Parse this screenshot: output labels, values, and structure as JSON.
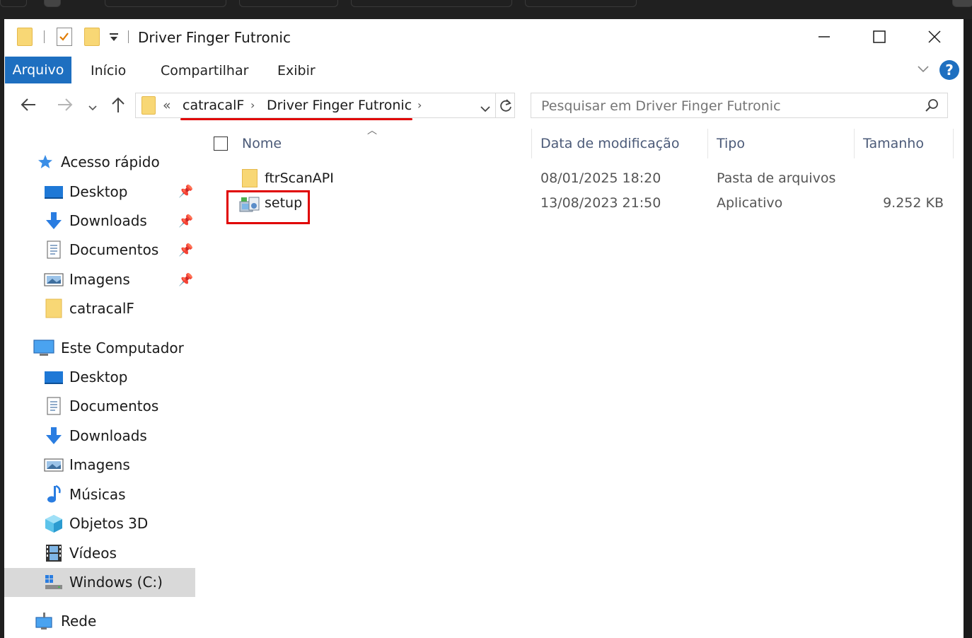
{
  "window": {
    "title": "Driver Finger Futronic"
  },
  "ribbon": {
    "tabs": [
      "Arquivo",
      "Início",
      "Compartilhar",
      "Exibir"
    ]
  },
  "address": {
    "prefix": "«",
    "crumbs": [
      "catracalF",
      "Driver Finger Futronic"
    ]
  },
  "search": {
    "placeholder": "Pesquisar em Driver Finger Futronic"
  },
  "nav": {
    "quick_access": {
      "label": "Acesso rápido",
      "items": [
        "Desktop",
        "Downloads",
        "Documentos",
        "Imagens",
        "catracalF"
      ]
    },
    "this_pc": {
      "label": "Este Computador",
      "items": [
        "Desktop",
        "Documentos",
        "Downloads",
        "Imagens",
        "Músicas",
        "Objetos 3D",
        "Vídeos",
        "Windows (C:)"
      ]
    },
    "network": {
      "label": "Rede"
    }
  },
  "columns": {
    "name": "Nome",
    "date": "Data de modificação",
    "type": "Tipo",
    "size": "Tamanho"
  },
  "files": [
    {
      "name": "ftrScanAPI",
      "date": "08/01/2025 18:20",
      "type": "Pasta de arquivos",
      "size": ""
    },
    {
      "name": "setup",
      "date": "13/08/2023 21:50",
      "type": "Aplicativo",
      "size": "9.252 KB"
    }
  ],
  "colors": {
    "accent": "#1e6fc0",
    "highlight": "#e00000",
    "folder": "#f8d775",
    "header_text": "#4b5a78"
  }
}
